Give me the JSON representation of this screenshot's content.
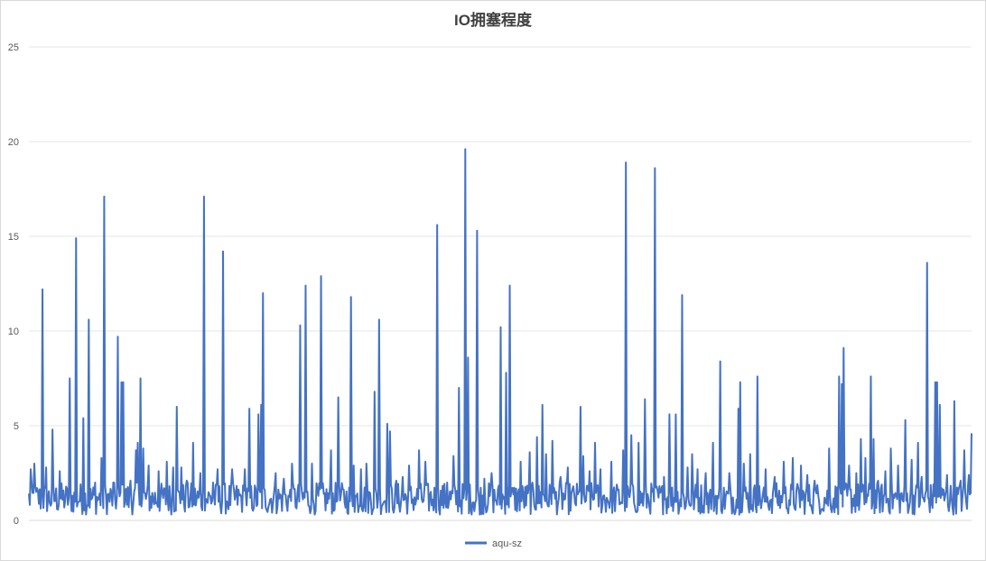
{
  "chart_data": {
    "type": "line",
    "title": "IO拥塞程度",
    "xlabel": "",
    "ylabel": "",
    "ylim": [
      0,
      25
    ],
    "yticks": [
      "0",
      "5",
      "10",
      "15",
      "20",
      "25"
    ],
    "grid": true,
    "legend_position": "bottom",
    "series_color": "#4472c4",
    "n_points": 1040,
    "baseline_band": [
      0.3,
      2.0
    ],
    "series": [
      {
        "name": "aqu-sz",
        "peaks": [
          [
            2,
            2.7
          ],
          [
            6,
            3.0
          ],
          [
            15,
            12.2
          ],
          [
            19,
            2.8
          ],
          [
            26,
            4.8
          ],
          [
            34,
            2.6
          ],
          [
            45,
            7.5
          ],
          [
            52,
            14.9
          ],
          [
            60,
            5.4
          ],
          [
            66,
            10.6
          ],
          [
            73,
            2.0
          ],
          [
            80,
            3.3
          ],
          [
            83,
            17.1
          ],
          [
            93,
            2.0
          ],
          [
            98,
            9.7
          ],
          [
            102,
            7.3
          ],
          [
            104,
            7.3
          ],
          [
            112,
            2.1
          ],
          [
            118,
            3.7
          ],
          [
            120,
            4.1
          ],
          [
            123,
            7.5
          ],
          [
            126,
            3.8
          ],
          [
            132,
            2.9
          ],
          [
            143,
            2.6
          ],
          [
            152,
            3.1
          ],
          [
            159,
            2.8
          ],
          [
            163,
            6.0
          ],
          [
            168,
            2.8
          ],
          [
            174,
            2.1
          ],
          [
            181,
            4.1
          ],
          [
            189,
            2.5
          ],
          [
            193,
            17.1
          ],
          [
            203,
            2.0
          ],
          [
            208,
            2.7
          ],
          [
            214,
            14.2
          ],
          [
            224,
            2.7
          ],
          [
            238,
            2.7
          ],
          [
            243,
            5.9
          ],
          [
            253,
            5.6
          ],
          [
            256,
            6.1
          ],
          [
            258,
            12.0
          ],
          [
            272,
            2.5
          ],
          [
            281,
            2.2
          ],
          [
            290,
            3.0
          ],
          [
            299,
            10.3
          ],
          [
            305,
            12.4
          ],
          [
            312,
            3.0
          ],
          [
            322,
            12.9
          ],
          [
            333,
            3.7
          ],
          [
            341,
            6.5
          ],
          [
            355,
            11.8
          ],
          [
            358,
            2.9
          ],
          [
            366,
            2.7
          ],
          [
            372,
            3.0
          ],
          [
            381,
            6.8
          ],
          [
            386,
            10.6
          ],
          [
            395,
            5.1
          ],
          [
            398,
            4.7
          ],
          [
            405,
            2.1
          ],
          [
            412,
            2.3
          ],
          [
            419,
            2.9
          ],
          [
            430,
            3.7
          ],
          [
            437,
            3.1
          ],
          [
            450,
            15.6
          ],
          [
            461,
            2.0
          ],
          [
            468,
            3.4
          ],
          [
            474,
            7.0
          ],
          [
            481,
            19.6
          ],
          [
            484,
            8.6
          ],
          [
            494,
            15.3
          ],
          [
            502,
            2.2
          ],
          [
            510,
            2.5
          ],
          [
            520,
            10.2
          ],
          [
            526,
            7.8
          ],
          [
            530,
            12.4
          ],
          [
            542,
            3.1
          ],
          [
            552,
            3.6
          ],
          [
            560,
            4.4
          ],
          [
            566,
            6.1
          ],
          [
            570,
            3.5
          ],
          [
            577,
            4.2
          ],
          [
            586,
            2.3
          ],
          [
            594,
            2.8
          ],
          [
            608,
            6.0
          ],
          [
            611,
            3.4
          ],
          [
            618,
            2.6
          ],
          [
            624,
            4.1
          ],
          [
            630,
            2.7
          ],
          [
            642,
            3.1
          ],
          [
            655,
            3.7
          ],
          [
            658,
            18.9
          ],
          [
            664,
            4.5
          ],
          [
            672,
            4.1
          ],
          [
            679,
            6.4
          ],
          [
            690,
            18.6
          ],
          [
            700,
            2.3
          ],
          [
            706,
            5.6
          ],
          [
            713,
            5.6
          ],
          [
            720,
            11.9
          ],
          [
            726,
            2.8
          ],
          [
            731,
            3.5
          ],
          [
            737,
            2.7
          ],
          [
            746,
            2.5
          ],
          [
            754,
            4.1
          ],
          [
            762,
            8.4
          ],
          [
            772,
            2.5
          ],
          [
            782,
            5.9
          ],
          [
            784,
            7.3
          ],
          [
            788,
            3.0
          ],
          [
            795,
            3.5
          ],
          [
            803,
            7.6
          ],
          [
            812,
            2.7
          ],
          [
            822,
            2.3
          ],
          [
            832,
            3.1
          ],
          [
            842,
            3.3
          ],
          [
            851,
            2.9
          ],
          [
            858,
            2.4
          ],
          [
            866,
            2.1
          ],
          [
            882,
            3.8
          ],
          [
            893,
            7.6
          ],
          [
            896,
            7.2
          ],
          [
            898,
            9.1
          ],
          [
            904,
            2.9
          ],
          [
            912,
            2.5
          ],
          [
            917,
            4.3
          ],
          [
            922,
            3.3
          ],
          [
            928,
            7.6
          ],
          [
            931,
            4.3
          ],
          [
            936,
            2.1
          ],
          [
            944,
            2.6
          ],
          [
            950,
            3.8
          ],
          [
            958,
            2.9
          ],
          [
            966,
            5.3
          ],
          [
            973,
            3.2
          ],
          [
            980,
            4.1
          ],
          [
            984,
            2.3
          ],
          [
            990,
            13.6
          ],
          [
            999,
            7.3
          ],
          [
            1001,
            7.3
          ],
          [
            1004,
            6.1
          ],
          [
            1012,
            2.4
          ],
          [
            1020,
            6.3
          ],
          [
            1027,
            2.1
          ],
          [
            1031,
            3.7
          ],
          [
            1036,
            2.4
          ],
          [
            1039,
            4.6
          ]
        ]
      }
    ]
  }
}
